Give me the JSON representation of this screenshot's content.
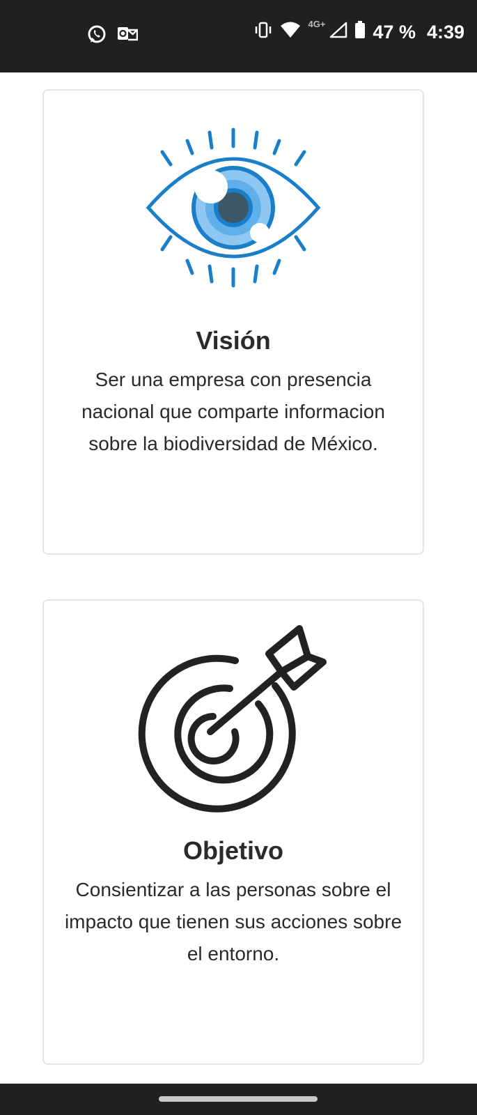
{
  "status_bar": {
    "left_icons": [
      "whatsapp-icon",
      "outlook-icon"
    ],
    "right_icons": [
      "vibrate-icon",
      "wifi-icon",
      "signal-icon",
      "battery-icon"
    ],
    "network": "4G+",
    "battery": "47 %",
    "time": "4:39"
  },
  "cards": {
    "vision": {
      "icon": "eye-icon",
      "title": "Visión",
      "text": "Ser una empresa con presencia nacional que comparte informacion sobre la biodiversidad de México."
    },
    "objetivo": {
      "icon": "target-icon",
      "title": "Objetivo",
      "text": "Consientizar a las personas sobre el impacto que tienen sus acciones sobre el entorno."
    }
  },
  "colors": {
    "status_bar_bg": "#202020",
    "eye_blue": "#1a7ec9",
    "eye_light_blue": "#8ec8f2",
    "text": "#2a2a2a",
    "card_border": "#e4e4e4"
  }
}
